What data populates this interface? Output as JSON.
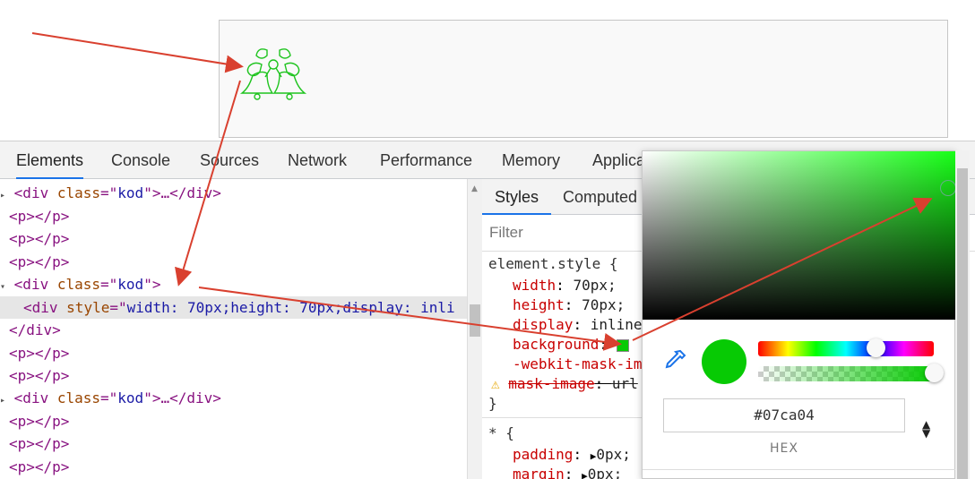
{
  "devtools": {
    "tabs": [
      "Elements",
      "Console",
      "Sources",
      "Network",
      "Performance",
      "Memory",
      "Applica"
    ],
    "active_tab": "Elements"
  },
  "elements": {
    "lines": [
      {
        "open": "<div ",
        "attr": "class",
        "eq": "=\"",
        "val": "kod",
        "close": "\">…</div>"
      },
      {
        "text": "<p></p>"
      },
      {
        "text": "<p></p>"
      },
      {
        "text": "<p></p>"
      },
      {
        "open": "<div ",
        "attr": "class",
        "eq": "=\"",
        "val": "kod",
        "close": "\">"
      },
      {
        "open": "<div ",
        "attr": "style",
        "eq": "=\"",
        "val": "width: 70px;height: 70px;display: inli",
        "close": ""
      },
      {
        "text": "</div>"
      },
      {
        "text": "<p></p>"
      },
      {
        "text": "<p></p>"
      },
      {
        "open": "<div ",
        "attr": "class",
        "eq": "=\"",
        "val": "kod",
        "close": "\">…</div>"
      },
      {
        "text": "<p></p>"
      },
      {
        "text": "<p></p>"
      },
      {
        "text": "<p></p>"
      }
    ]
  },
  "styles": {
    "subtabs": [
      "Styles",
      "Computed"
    ],
    "filter_placeholder": "Filter",
    "element_style": "element.style {",
    "rules": [
      {
        "prop": "width",
        "val": "70px;"
      },
      {
        "prop": "height",
        "val": "70px;"
      },
      {
        "prop": "display",
        "val": "inline"
      },
      {
        "prop": "background",
        "val": ""
      },
      {
        "prop": "-webkit-mask-im",
        "val": ""
      },
      {
        "prop": "mask-image",
        "val": "url"
      }
    ],
    "close_brace": "}",
    "universal": "* {",
    "rules2": [
      {
        "prop": "padding",
        "val": "0px;"
      },
      {
        "prop": "margin",
        "val": "0px;"
      }
    ]
  },
  "picker": {
    "hex_value": "#07ca04",
    "format_label": "HEX",
    "color": "#07ca04"
  },
  "colors": {
    "arrow": "#d9402f",
    "bells": "#1fc41f"
  }
}
